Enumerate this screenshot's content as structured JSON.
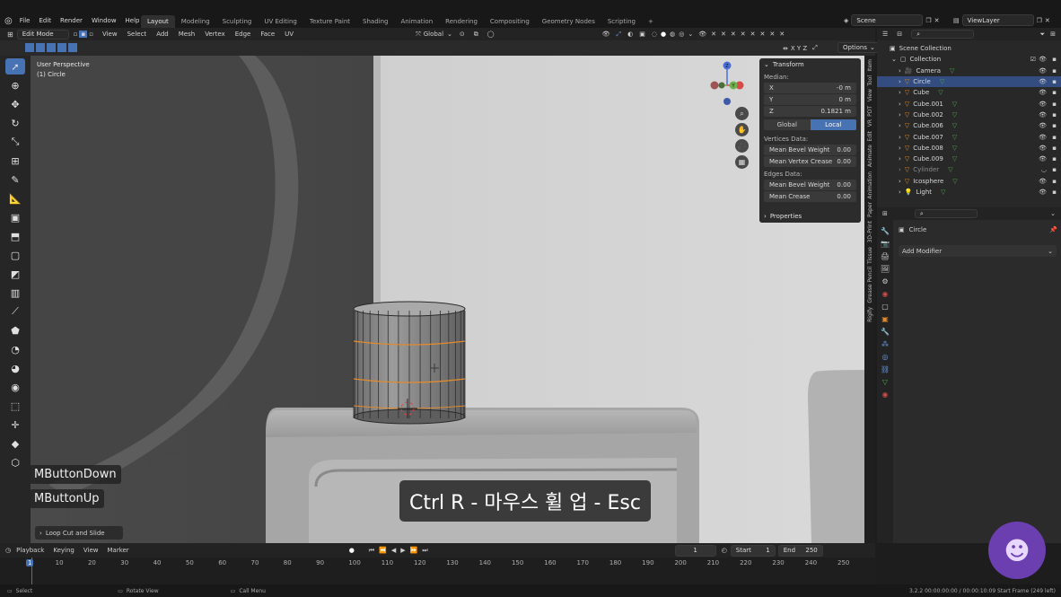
{
  "menu": [
    "File",
    "Edit",
    "Render",
    "Window",
    "Help"
  ],
  "workspaces": [
    "Layout",
    "Modeling",
    "Sculpting",
    "UV Editing",
    "Texture Paint",
    "Shading",
    "Animation",
    "Rendering",
    "Compositing",
    "Geometry Nodes",
    "Scripting"
  ],
  "workspace_add": "+",
  "scene": "Scene",
  "view_layer": "ViewLayer",
  "header": {
    "mode": "Edit Mode",
    "menus": [
      "View",
      "Select",
      "Add",
      "Mesh",
      "Vertex",
      "Edge",
      "Face",
      "UV"
    ],
    "orientation": "Global",
    "options": "Options",
    "axes": "X Y Z"
  },
  "viewport": {
    "perspective": "User Perspective",
    "object": "(1) Circle"
  },
  "npanel": {
    "section": "Transform",
    "median": "Median:",
    "fields": [
      {
        "label": "X",
        "value": "-0 m"
      },
      {
        "label": "Y",
        "value": "0 m"
      },
      {
        "label": "Z",
        "value": "0.1821 m"
      }
    ],
    "space_global": "Global",
    "space_local": "Local",
    "vertices_data": "Vertices Data:",
    "vertex_fields": [
      {
        "label": "Mean Bevel Weight",
        "value": "0.00"
      },
      {
        "label": "Mean Vertex Crease",
        "value": "0.00"
      }
    ],
    "edges_data": "Edges Data:",
    "edge_fields": [
      {
        "label": "Mean Bevel Weight",
        "value": "0.00"
      },
      {
        "label": "Mean Crease",
        "value": "0.00"
      }
    ],
    "properties": "Properties"
  },
  "side_tabs": [
    "Item",
    "Tool",
    "View",
    "PDT",
    "VR",
    "Edit",
    "Animate",
    "Animation",
    "Paper",
    "3D-Print",
    "Tissue",
    "Grease Pencil",
    "Rigify"
  ],
  "outliner": {
    "root": "Scene Collection",
    "collection": "Collection",
    "items": [
      "Camera",
      "Circle",
      "Cube",
      "Cube.001",
      "Cube.002",
      "Cube.006",
      "Cube.007",
      "Cube.008",
      "Cube.009",
      "Cylinder",
      "Icosphere",
      "Light"
    ],
    "selected": "Circle"
  },
  "properties": {
    "object": "Circle",
    "add_modifier": "Add Modifier"
  },
  "overlay": {
    "key1": "MButtonDown",
    "key2": "MButtonUp",
    "operator": "Loop Cut and Slide",
    "subtitle": "Ctrl R - 마우스 휠 업 - Esc"
  },
  "timeline": {
    "menus": [
      "Playback",
      "Keying",
      "View",
      "Marker"
    ],
    "current_frame": "1",
    "start_label": "Start",
    "start": "1",
    "end_label": "End",
    "end": "250",
    "ticks": [
      "1",
      "10",
      "20",
      "30",
      "40",
      "50",
      "60",
      "70",
      "80",
      "90",
      "100",
      "110",
      "120",
      "130",
      "140",
      "150",
      "160",
      "170",
      "180",
      "190",
      "200",
      "210",
      "220",
      "230",
      "240",
      "250"
    ]
  },
  "status": {
    "select": "Select",
    "rotate": "Rotate View",
    "call_menu": "Call Menu",
    "info": "3.2.2  00:00:00:00 / 00:00:10:09  Start Frame (249 left)"
  },
  "colors": {
    "accent": "#4772b3",
    "selected_edge": "#e08a2e",
    "background": "#1d1d1d"
  }
}
